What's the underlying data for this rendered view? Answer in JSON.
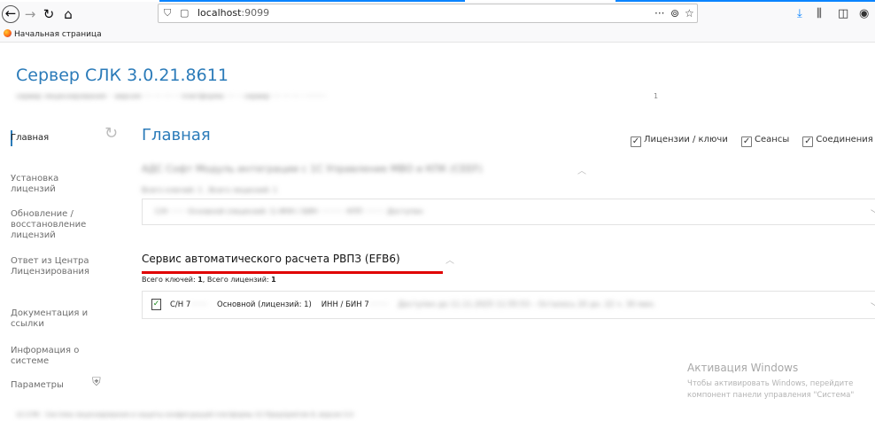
{
  "browser": {
    "url_host": "localhost",
    "url_port": ":9099",
    "bookmark": "Начальная страница",
    "page_actions": "···"
  },
  "app": {
    "title": "Сервер СЛК 3.0.21.8611",
    "subline_blurred": "сервер лицензирования ·· версия ···· ··· ···· ·· платформа ···· ·· сервер ···· ··· ··· · ·········",
    "subline_tail": "1"
  },
  "sidebar": {
    "items": [
      {
        "label": "Главная"
      },
      {
        "label": "Установка\nлицензий"
      },
      {
        "label": "Обновление /\nвосстановление\nлицензий"
      },
      {
        "label": "Ответ из Центра\nЛицензирования"
      },
      {
        "label": "Документация и\nссылки"
      },
      {
        "label": "Информация о\nсистеме"
      },
      {
        "label": "Параметры"
      }
    ]
  },
  "main": {
    "title": "Главная",
    "filters": [
      {
        "label": "Лицензии / ключи",
        "checked": true
      },
      {
        "label": "Сеансы",
        "checked": true
      },
      {
        "label": "Соединения",
        "checked": true
      }
    ],
    "group1": {
      "title_blurred": "АДС Софт Модуль интеграции с 1С Управление МВО и КПК (СЕЕF)",
      "meta_blurred": "Всего ключей: 1 , Всего лицензий: 1",
      "row_blurred": "С/Н ·······   Основной (лицензий: 1)   ИНН / БИН ···········   КПП ·········   Доступен"
    },
    "group2": {
      "title": "Сервис автоматического расчета РВПЗ (EFB6)",
      "keys_label": "Всего ключей:",
      "keys_value": "1",
      "sep": ",",
      "licenses_label": "Всего лицензий:",
      "licenses_value": "1",
      "row": {
        "sn_prefix": "С/Н 7",
        "sn_hidden": "·······",
        "kind": "Основной (лицензий: 1)",
        "inn_prefix": "ИНН / БИН 7",
        "inn_hidden": "········",
        "status_hidden": "Доступен до 11.11.2025 11:55:53 – Осталось 20 дн. 22 ч. 30 мин."
      }
    }
  },
  "watermark": {
    "title": "Активация Windows",
    "line1": "Чтобы активировать Windows, перейдите",
    "line2": "компонент панели управления \"Система\""
  },
  "footer": {
    "text_blurred": "1С:СЛК · Система лицензирования и защиты конфигураций платформы 1С:Предприятие 8, версия 3.0"
  }
}
